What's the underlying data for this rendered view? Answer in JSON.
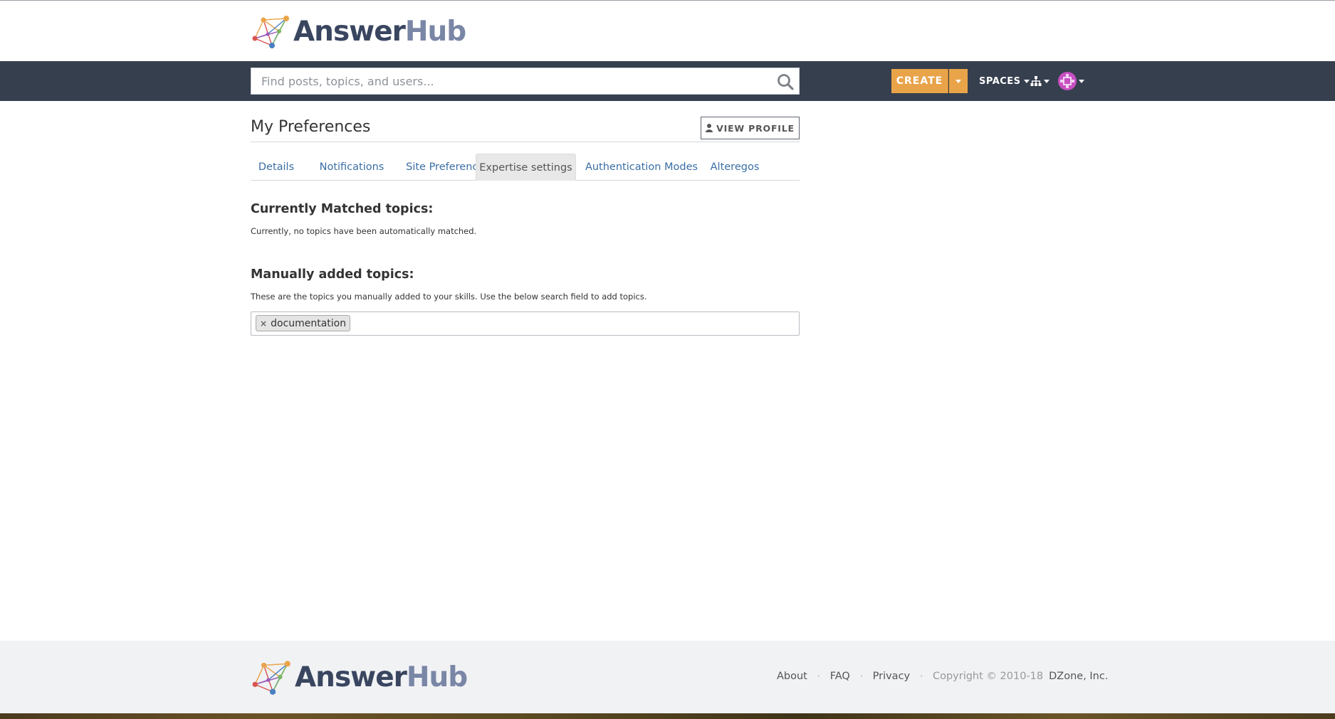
{
  "header": {
    "logo": {
      "part1": "Answer",
      "part2": "Hub"
    }
  },
  "navbar": {
    "search_placeholder": "Find posts, topics, and users...",
    "create_label": "CREATE",
    "spaces_label": "SPACES",
    "icons": {
      "search": "search-icon",
      "org": "sitemap-icon",
      "avatar": "user-avatar"
    }
  },
  "preferences": {
    "title": "My Preferences",
    "view_profile_label": "VIEW PROFILE",
    "tabs": [
      {
        "label": "Details"
      },
      {
        "label": "Notifications"
      },
      {
        "label": "Site Preferences"
      },
      {
        "label": "Expertise settings",
        "active": true
      },
      {
        "label": "Authentication Modes"
      },
      {
        "label": "Alteregos"
      }
    ],
    "matched": {
      "title": "Currently Matched topics:",
      "text": "Currently, no topics have been automatically matched."
    },
    "manual": {
      "title": "Manually added topics:",
      "text": "These are the topics you manually added to your skills. Use the below search field to add topics.",
      "tags": [
        "documentation"
      ]
    }
  },
  "footer": {
    "logo": {
      "part1": "Answer",
      "part2": "Hub"
    },
    "links": [
      "About",
      "FAQ",
      "Privacy"
    ],
    "copyright": "Copyright © 2010-18",
    "company": "DZone, Inc."
  },
  "colors": {
    "navbar": "#363f4e",
    "accent": "#e9a44a",
    "link": "#3a6ea5"
  }
}
